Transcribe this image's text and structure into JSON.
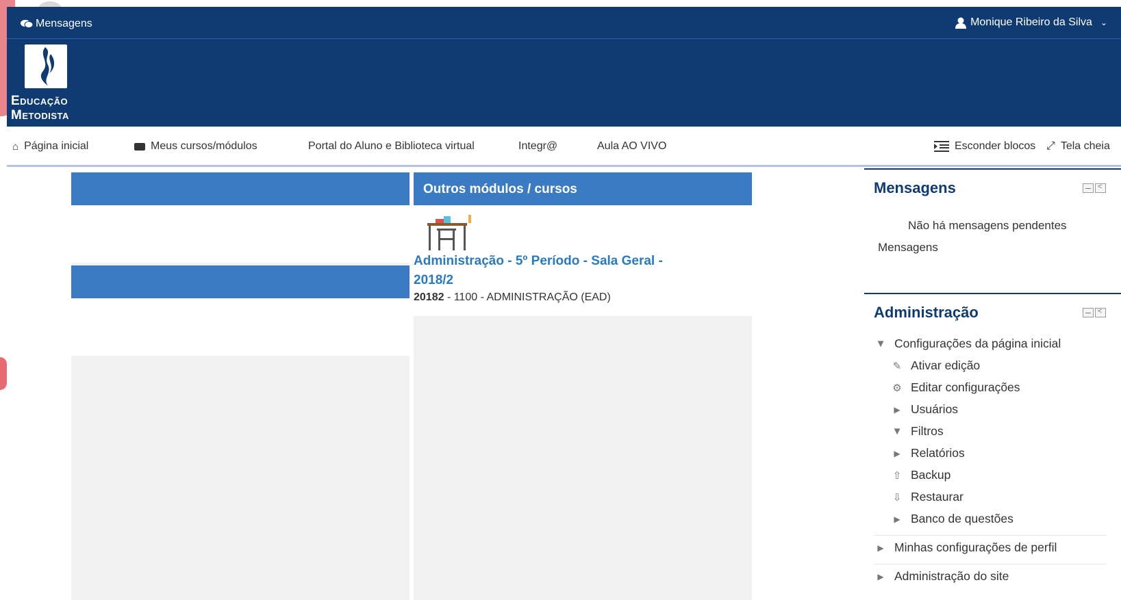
{
  "topbar": {
    "messages_label": "Mensagens",
    "user_name": "Monique Ribeiro da Silva"
  },
  "logo": {
    "line1": "Educação",
    "line2": "Metodista"
  },
  "nav": {
    "home": "Página inicial",
    "my_courses": "Meus cursos/módulos",
    "portal": "Portal do Aluno e Biblioteca virtual",
    "integra": "Integr@",
    "live": "Aula AO VIVO",
    "hide_blocks": "Esconder blocos",
    "fullscreen": "Tela cheia"
  },
  "main": {
    "other_modules_title": "Outros módulos / cursos",
    "course": {
      "title": "Administração - 5º Período - Sala Geral - 2018/2",
      "code": "20182",
      "detail": " - 1100 - ADMINISTRAÇÃO (EAD)"
    }
  },
  "sidebar": {
    "messages_block": {
      "title": "Mensagens",
      "none_text": "Não há mensagens pendentes",
      "link": "Mensagens"
    },
    "admin_block": {
      "title": "Administração",
      "section": "Configurações da página inicial",
      "items": [
        {
          "label": "Ativar edição",
          "icon": "pencil-icon"
        },
        {
          "label": "Editar configurações",
          "icon": "gear-icon"
        },
        {
          "label": "Usuários",
          "icon": "caret-right-icon"
        },
        {
          "label": "Filtros",
          "icon": "filter-icon"
        },
        {
          "label": "Relatórios",
          "icon": "caret-right-icon"
        },
        {
          "label": "Backup",
          "icon": "upload-icon"
        },
        {
          "label": "Restaurar",
          "icon": "download-icon"
        },
        {
          "label": "Banco de questões",
          "icon": "caret-right-icon"
        }
      ],
      "profile_settings": "Minhas configurações de perfil",
      "site_admin": "Administração do site"
    }
  },
  "colors": {
    "navy": "#103b72",
    "blue_band": "#3a7bc3",
    "link": "#2a7ac1"
  }
}
